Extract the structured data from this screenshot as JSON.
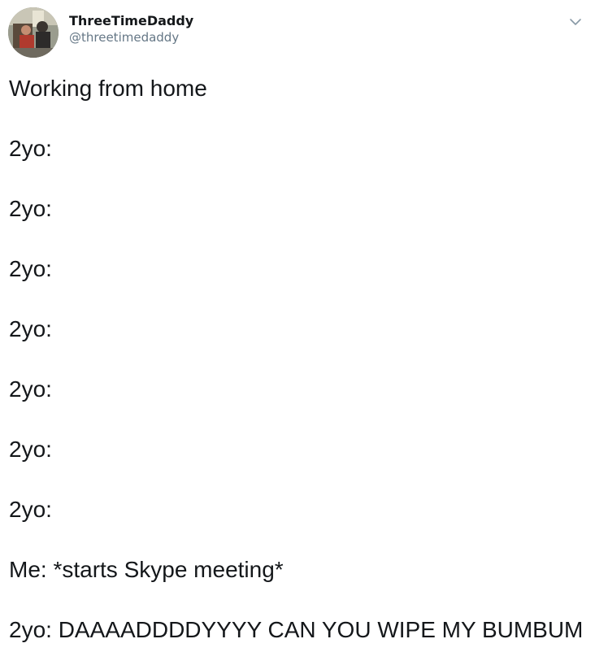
{
  "user": {
    "display_name": "ThreeTimeDaddy",
    "handle": "@threetimedaddy"
  },
  "icons": {
    "avatar": "profile-photo",
    "menu": "chevron-down-icon"
  },
  "colors": {
    "text": "#14171a",
    "handle": "#657786",
    "caret": "#8899a6"
  },
  "tweet": {
    "lines": [
      "Working from home",
      "2yo:",
      "2yo:",
      "2yo:",
      "2yo:",
      "2yo:",
      "2yo:",
      "2yo:",
      "Me: *starts Skype meeting*",
      "2yo: DAAAADDDDYYYY CAN YOU WIPE MY BUMBUM"
    ]
  }
}
